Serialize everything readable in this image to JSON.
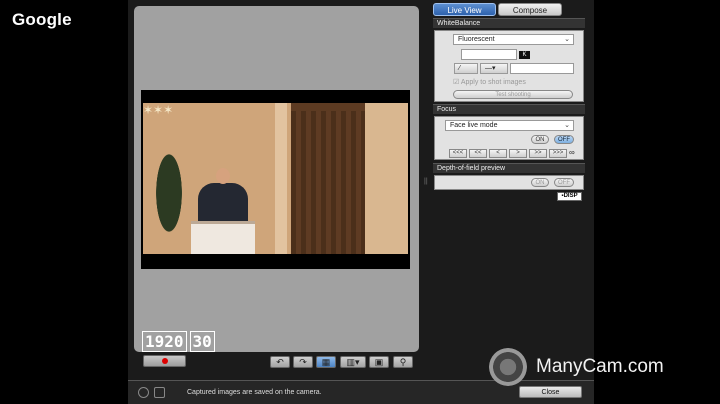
{
  "brand": {
    "google": "Google",
    "manycam": "ManyCam.com"
  },
  "tabs": {
    "live": "Live View",
    "compose": "Compose"
  },
  "white_balance": {
    "title": "WhiteBalance",
    "mode": "Fluorescent",
    "k_badge": "K",
    "apply_label": "Apply to shot images",
    "test_shooting": "Test shooting"
  },
  "focus": {
    "title": "Focus",
    "mode": "Face live mode",
    "on": "ON",
    "off": "OFF",
    "nav": [
      "<<<",
      "<<",
      "<",
      ">",
      ">>",
      ">>>"
    ],
    "infinity": "∞"
  },
  "dof": {
    "title": "Depth-of-field preview",
    "on": "ON",
    "off": "OFF",
    "disp": "DISP"
  },
  "video": {
    "res": "1920",
    "fps": "30"
  },
  "status": {
    "message": "Captured images are saved on the camera.",
    "close": "Close"
  },
  "icons": {
    "record": "record-icon",
    "rotate_left": "rotate-left-icon",
    "rotate_right": "rotate-right-icon",
    "grid": "grid-icon",
    "aspect": "aspect-icon",
    "zoom": "zoom-icon"
  }
}
